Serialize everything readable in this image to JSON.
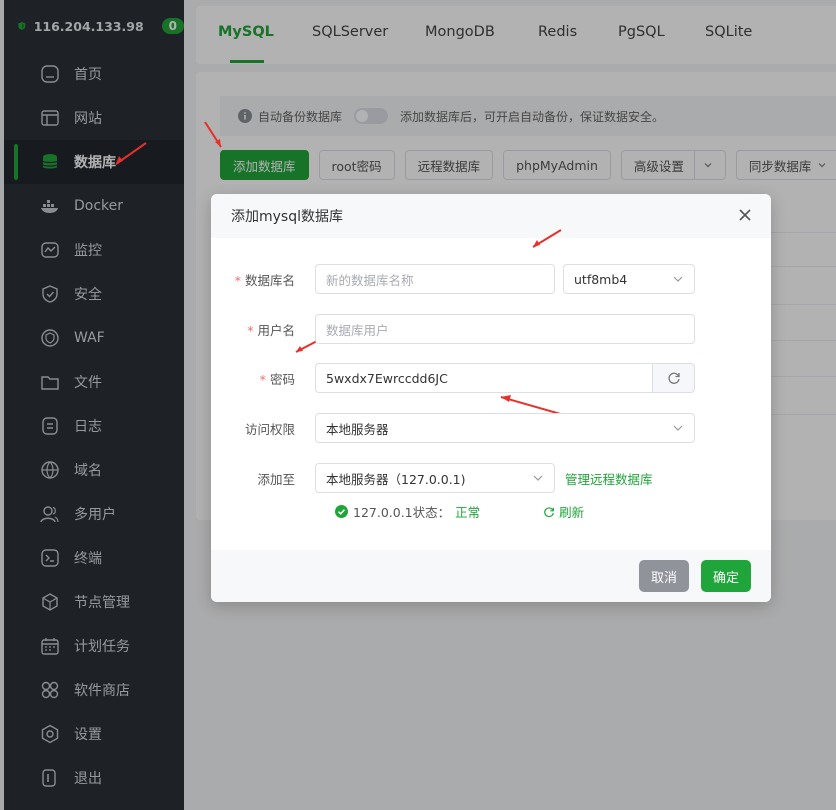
{
  "server": {
    "ip": "116.204.133.98",
    "badge": "0"
  },
  "sidebar": {
    "items": [
      {
        "label": "首页",
        "icon": "home-icon"
      },
      {
        "label": "网站",
        "icon": "website-icon"
      },
      {
        "label": "数据库",
        "icon": "database-icon",
        "active": true
      },
      {
        "label": "Docker",
        "icon": "docker-icon"
      },
      {
        "label": "监控",
        "icon": "monitor-icon"
      },
      {
        "label": "安全",
        "icon": "shield-icon"
      },
      {
        "label": "WAF",
        "icon": "waf-icon"
      },
      {
        "label": "文件",
        "icon": "folder-icon"
      },
      {
        "label": "日志",
        "icon": "log-icon"
      },
      {
        "label": "域名",
        "icon": "globe-icon"
      },
      {
        "label": "多用户",
        "icon": "users-icon"
      },
      {
        "label": "终端",
        "icon": "terminal-icon"
      },
      {
        "label": "节点管理",
        "icon": "node-icon"
      },
      {
        "label": "计划任务",
        "icon": "calendar-icon"
      },
      {
        "label": "软件商店",
        "icon": "store-icon"
      },
      {
        "label": "设置",
        "icon": "settings-icon"
      },
      {
        "label": "退出",
        "icon": "logout-icon"
      }
    ]
  },
  "tabs": [
    "MySQL",
    "SQLServer",
    "MongoDB",
    "Redis",
    "PgSQL",
    "SQLite"
  ],
  "notice": {
    "label": "自动备份数据库",
    "text": "添加数据库后，可开启自动备份，保证数据安全。"
  },
  "toolbar": {
    "add_db": "添加数据库",
    "root_pwd": "root密码",
    "remote_db": "远程数据库",
    "phpmyadmin": "phpMyAdmin",
    "advanced": "高级设置",
    "sync": "同步数据库"
  },
  "dialog": {
    "title": "添加mysql数据库",
    "db_name_label": "数据库名",
    "db_name_placeholder": "新的数据库名称",
    "charset": "utf8mb4",
    "user_label": "用户名",
    "user_placeholder": "数据库用户",
    "password_label": "密码",
    "password_value": "5wxdx7Ewrccdd6JC",
    "access_label": "访问权限",
    "access_value": "本地服务器",
    "add_to_label": "添加至",
    "add_to_value": "本地服务器（127.0.0.1)",
    "manage_remote": "管理远程数据库",
    "status_text": "127.0.0.1状态：",
    "status_value": "正常",
    "refresh": "刷新",
    "cancel": "取消",
    "confirm": "确定"
  },
  "colors": {
    "accent": "#20a53a",
    "annotation": "#e8302a"
  }
}
